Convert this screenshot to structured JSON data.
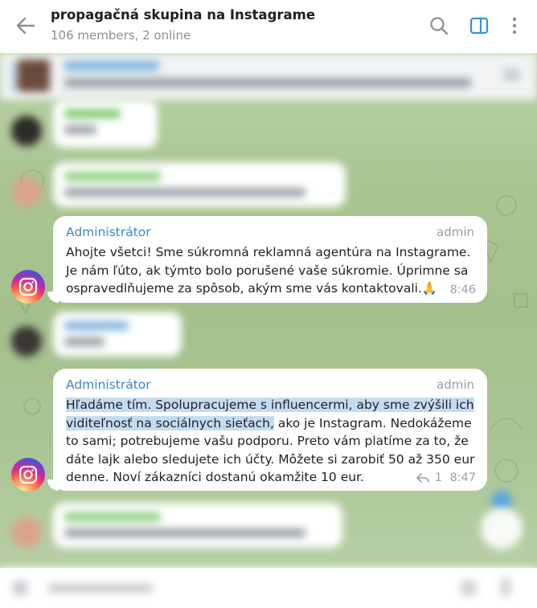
{
  "header": {
    "title": "propagačná skupina na Instagrame",
    "subtitle": "106 members, 2 online",
    "icons": [
      "back-arrow-icon",
      "search-icon",
      "sidebar-panel-icon",
      "more-vertical-icon"
    ],
    "accent": "#3390ec"
  },
  "messages": [
    {
      "sender": "Administrátor",
      "role": "admin",
      "text": "Ahojte všetci! Sme súkromná reklamná agentúra na Instagrame. Je nám ľúto, ak týmto bolo porušené vaše súkromie. Úprimne sa ospravedlňujeme za spôsob, akým sme vás kontaktovali.🙏",
      "time": "8:46"
    },
    {
      "sender": "Administrátor",
      "role": "admin",
      "text_highlighted": "Hľadáme tím. Spolupracujeme s influencermi, aby sme zvýšili ich viditeľnosť na sociálnych sieťach,",
      "text_rest": " ako je Instagram. Nedokážeme to sami; potrebujeme vašu podporu. Preto vám platíme za to, že dáte lajk alebo sledujete ich účty. Môžete si zarobiť 50 až 350 eur denne. Noví zákazníci dostanú okamžite 10 eur.",
      "replies": "1",
      "time": "8:47"
    }
  ],
  "colors": {
    "sender_name": "#3d87c4",
    "highlight": "#c4dcf2",
    "chat_background": "#a9c592"
  }
}
